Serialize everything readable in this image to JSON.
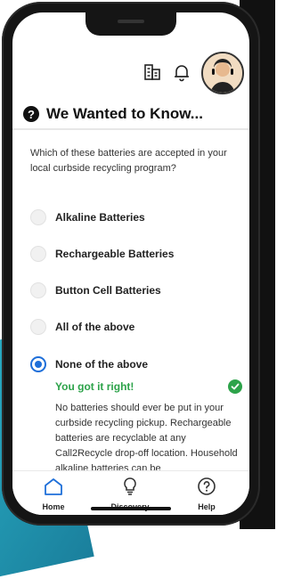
{
  "header": {
    "section_title": "We Wanted to Know...",
    "help_mark": "?"
  },
  "question": {
    "text": "Which of these batteries are accepted in your local curbside recycling program?"
  },
  "options": [
    {
      "label": "Alkaline Batteries",
      "selected": false
    },
    {
      "label": "Rechargeable Batteries",
      "selected": false
    },
    {
      "label": "Button Cell Batteries",
      "selected": false
    },
    {
      "label": "All of the above",
      "selected": false
    },
    {
      "label": "None of the above",
      "selected": true
    }
  ],
  "result": {
    "text": "You got it right!",
    "explanation": "No batteries should ever be put in your curbside recycling pickup. Rechargeable batteries are recyclable at any Call2Recycle drop-off location. Household alkaline batteries can be"
  },
  "nav": {
    "home_label": "Home",
    "discovery_label": "Discovery",
    "help_label": "Help"
  },
  "colors": {
    "accent_blue": "#1e6fd9",
    "success_green": "#2da34a"
  },
  "icons": {
    "top_doc": "building-doc-icon",
    "top_bell": "bell-icon",
    "nav_home": "home-icon",
    "nav_discovery": "lightbulb-icon",
    "nav_help": "help-circle-icon",
    "result_check": "check-circle-icon"
  }
}
